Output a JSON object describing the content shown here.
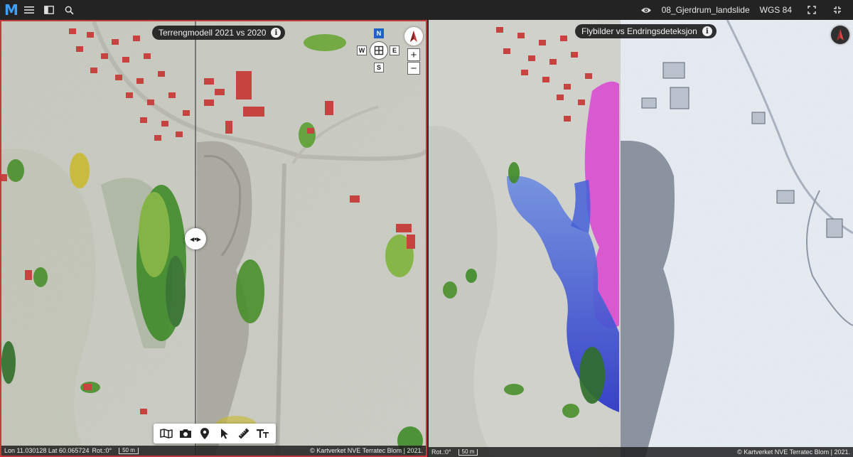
{
  "app": {
    "logo_letter": "M",
    "project_name": "08_Gjerdrum_landslide",
    "crs": "WGS 84"
  },
  "left_pane": {
    "layer_label": "Terrengmodell 2021 vs 2020",
    "nav": {
      "n": "N",
      "s": "S",
      "e": "E",
      "w": "W"
    },
    "zoom_in": "+",
    "zoom_out": "−",
    "status": {
      "coords": "Lon 11.030128 Lat 60.065724",
      "rotation": "Rot.:0°",
      "scale": "50 m",
      "attribution": "© Kartverket NVE Terratec Blom | 2021."
    }
  },
  "right_pane": {
    "layer_label": "Flybilder vs Endringsdeteksjon",
    "status": {
      "rotation": "Rot.:0°",
      "scale": "50 m",
      "attribution": "© Kartverket NVE Terratec Blom | 2021."
    }
  },
  "colors": {
    "accent": "#3ea1ff",
    "nav_north": "#1e63c4",
    "active_pane_border": "#c23a3a",
    "change_negative": "#3a4fd8",
    "change_positive": "#d94fd0"
  }
}
